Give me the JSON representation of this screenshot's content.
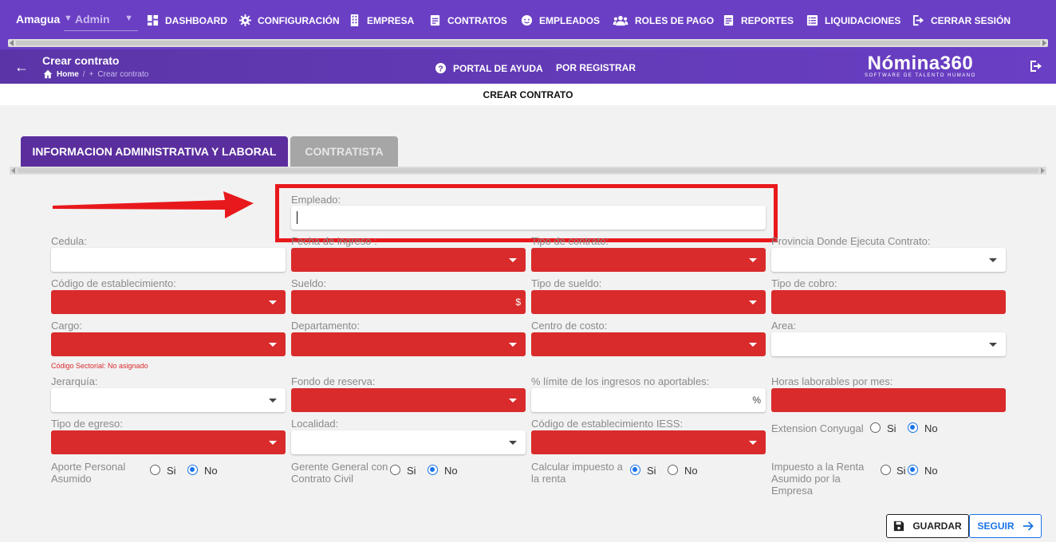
{
  "topnav": {
    "company": "Amagua",
    "role": "Admin",
    "items": [
      {
        "label": "DASHBOARD",
        "icon": "dashboard-icon"
      },
      {
        "label": "CONFIGURACIÓN",
        "icon": "gear-icon"
      },
      {
        "label": "EMPRESA",
        "icon": "building-icon"
      },
      {
        "label": "CONTRATOS",
        "icon": "document-icon"
      },
      {
        "label": "EMPLEADOS",
        "icon": "face-icon"
      },
      {
        "label": "ROLES DE PAGO",
        "icon": "group-icon"
      },
      {
        "label": "REPORTES",
        "icon": "report-icon"
      },
      {
        "label": "LIQUIDACIONES",
        "icon": "list-icon"
      },
      {
        "label": "CERRAR SESIÓN",
        "icon": "logout-icon"
      }
    ]
  },
  "subheader": {
    "title": "Crear contrato",
    "breadcrumb_home": "Home",
    "breadcrumb_sep": "/",
    "breadcrumb_current": "Crear contrato",
    "help": "PORTAL DE AYUDA",
    "register": "POR REGISTRAR",
    "logo_name": "Nómina360",
    "logo_tagline": "SOFTWARE DE TALENTO HUMANO"
  },
  "form_title": "CREAR CONTRATO",
  "tabs": [
    {
      "label": "INFORMACION ADMINISTRATIVA Y LABORAL",
      "active": true
    },
    {
      "label": "CONTRATISTA",
      "active": false
    }
  ],
  "fields": {
    "empleado": "Empleado:",
    "cedula": "Cedula:",
    "fecha_ingreso": "Fecha de ingreso :",
    "tipo_contrato": "Tipo de contrato:",
    "provincia": "Provincia Donde Ejecuta Contrato:",
    "codigo_establecimiento": "Código de establecimiento:",
    "sueldo": "Sueldo:",
    "sueldo_suffix": "$",
    "tipo_sueldo": "Tipo de sueldo:",
    "tipo_cobro": "Tipo de cobro:",
    "cargo": "Cargo:",
    "cargo_hint": "Código Sectorial: No asignado",
    "departamento": "Departamento:",
    "centro_costo": "Centro de costo:",
    "area": "Area:",
    "jerarquia": "Jerarquía:",
    "fondo_reserva": "Fondo de reserva:",
    "limite_ingresos": "% límite de los ingresos no aportables:",
    "limite_suffix": "%",
    "horas_laborables": "Horas laborables por mes:",
    "tipo_egreso": "Tipo de egreso:",
    "localidad": "Localidad:",
    "codigo_iess": "Código de establecimiento IESS:"
  },
  "radios": {
    "yes": "Si",
    "no": "No",
    "extension_conyugal": {
      "label": "Extension Conyugal",
      "selected": "No"
    },
    "aporte_personal": {
      "label": "Aporte Personal Asumido",
      "selected": "No"
    },
    "gerente_general": {
      "label": "Gerente General con Contrato Civil",
      "selected": "No"
    },
    "calcular_impuesto": {
      "label": "Calcular impuesto a la renta",
      "selected": "Si"
    },
    "impuesto_renta": {
      "label": "Impuesto a la Renta Asumido por la Empresa",
      "selected": "No"
    }
  },
  "buttons": {
    "save": "GUARDAR",
    "next": "SEGUIR"
  },
  "colors": {
    "nav": "#6a3fc4",
    "tab_active": "#5b2e9e",
    "required": "#d92b2b",
    "highlight": "#e8191c",
    "accent": "#1a73e8"
  }
}
